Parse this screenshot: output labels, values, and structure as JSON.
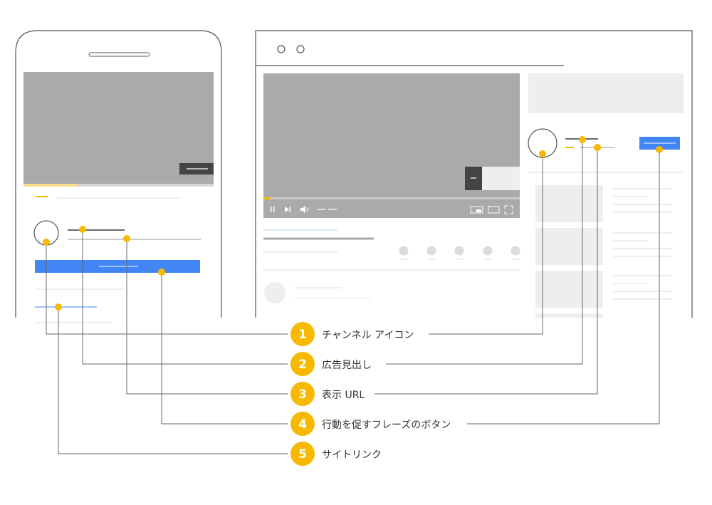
{
  "colors": {
    "outline": "#555555",
    "video": "#a9aaaa",
    "placeholder": "#eeeeee",
    "accent_yellow": "#f6b900",
    "button_blue": "#4285f4",
    "dark": "#444444",
    "connector": "#666666",
    "label_text": "#333333"
  },
  "legend": [
    {
      "number": "1",
      "label": "チャンネル アイコン"
    },
    {
      "number": "2",
      "label": "広告見出し"
    },
    {
      "number": "3",
      "label": "表示 URL"
    },
    {
      "number": "4",
      "label": "行動を促すフレーズのボタン"
    },
    {
      "number": "5",
      "label": "サイトリンク"
    }
  ],
  "icons": {
    "player_controls": [
      "pause-icon",
      "skip-next-icon",
      "volume-icon"
    ],
    "player_right_controls": [
      "miniplayer-icon",
      "theater-icon",
      "fullscreen-icon"
    ]
  }
}
